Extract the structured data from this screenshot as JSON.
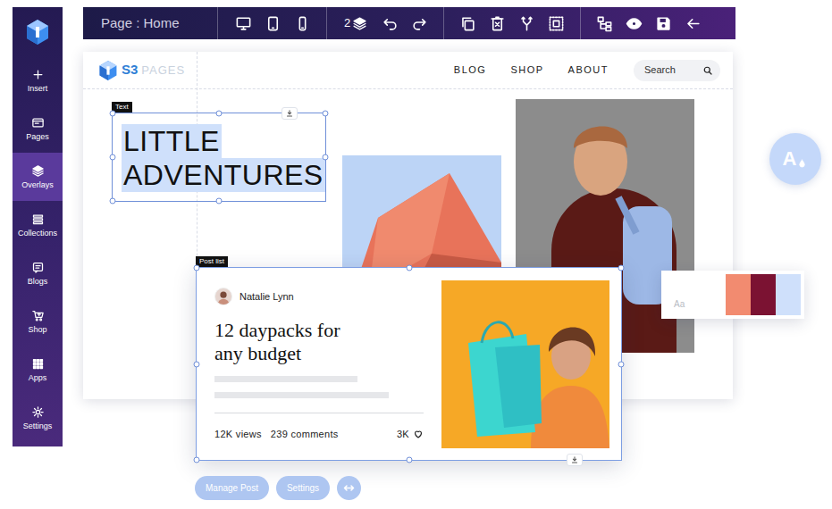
{
  "toolbar": {
    "page_label": "Page : Home",
    "layer_count": "2"
  },
  "sidebar": {
    "items": [
      {
        "label": "Insert",
        "selected": false
      },
      {
        "label": "Pages",
        "selected": false
      },
      {
        "label": "Overlays",
        "selected": true
      },
      {
        "label": "Collections",
        "selected": false
      },
      {
        "label": "Blogs",
        "selected": false
      },
      {
        "label": "Shop",
        "selected": false
      },
      {
        "label": "Apps",
        "selected": false
      },
      {
        "label": "Settings",
        "selected": false
      }
    ]
  },
  "site": {
    "logo_mark": "S3",
    "logo_word": "PAGES",
    "nav": [
      "BLOG",
      "SHOP",
      "ABOUT"
    ],
    "search": {
      "placeholder": "Search"
    }
  },
  "text_element": {
    "tag": "Text",
    "lines": [
      "LITTLE",
      "ADVENTURES"
    ]
  },
  "post_list": {
    "tag": "Post list",
    "author": "Natalie Lynn",
    "title_lines": [
      "12 daypacks for",
      "any budget"
    ],
    "views": "12K views",
    "comments": "239 comments",
    "likes": "3K"
  },
  "actions": [
    "Manage Post",
    "Settings"
  ],
  "theme_button": {
    "glyph": "A"
  },
  "palette": {
    "label": "Aa",
    "swatches": [
      {
        "color": "#f28b70"
      },
      {
        "color": "#7b1232"
      },
      {
        "color": "#cfe0fb"
      }
    ]
  }
}
